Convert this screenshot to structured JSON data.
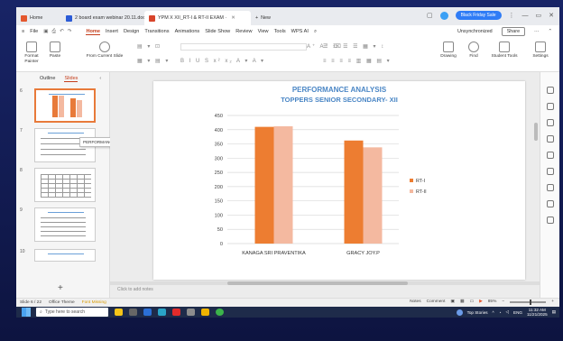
{
  "tabs": [
    {
      "label": "Home"
    },
    {
      "label": "2 board exam webinar 20.11.doc"
    },
    {
      "label": "YPM X XII_RT-I & RT-II EXAM ·"
    },
    {
      "label": "New"
    }
  ],
  "promo": {
    "label": "Black Friday Sale"
  },
  "menu": {
    "file": "File",
    "items": [
      "Home",
      "Insert",
      "Design",
      "Transitions",
      "Animations",
      "Slide Show",
      "Review",
      "View",
      "Tools",
      "WPS AI"
    ],
    "sync": "Unsynchronized",
    "share": "Share"
  },
  "ribbon": {
    "format_painter": "Format Painter",
    "paste": "Paste",
    "from_current_slide": "From Current Slide",
    "drawing": "Drawing",
    "find": "Find",
    "student_tools": "Student Tools",
    "settings": "Settings"
  },
  "left_panel": {
    "outline": "Outline",
    "slides": "Slides",
    "thumb_numbers": [
      "6",
      "7",
      "8",
      "9",
      "10"
    ],
    "tooltip": "PERFORMANCE ANALYSIS O TOPPE..."
  },
  "notes_placeholder": "Click to add notes",
  "status": {
    "slide": "Slide 6 / 22",
    "theme": "Office Theme",
    "font": "Font Missing",
    "notes": "Notes",
    "comment": "Comment",
    "zoom": "85%"
  },
  "taskbar": {
    "search": "Type here to search",
    "top_stories": "Top Stories",
    "lang": "ENG",
    "time": "11:32 AM",
    "date": "11/21/2025"
  },
  "chart_data": {
    "type": "bar",
    "title": "PERFORMANCE ANALYSIS",
    "subtitle": "TOPPERS SENIOR SECONDARY- XII",
    "categories": [
      "KANAGA SRI PRAVENTIKA",
      "GRACY JOY.P"
    ],
    "series": [
      {
        "name": "RT-I",
        "values": [
          410,
          362
        ],
        "color": "#ed7d31"
      },
      {
        "name": "RT-II",
        "values": [
          412,
          338
        ],
        "color": "#f4b9a0"
      }
    ],
    "ylim": [
      0,
      450
    ],
    "yticks": [
      0,
      50,
      100,
      150,
      200,
      250,
      300,
      350,
      400,
      450
    ],
    "grid": true,
    "legend": "right"
  }
}
